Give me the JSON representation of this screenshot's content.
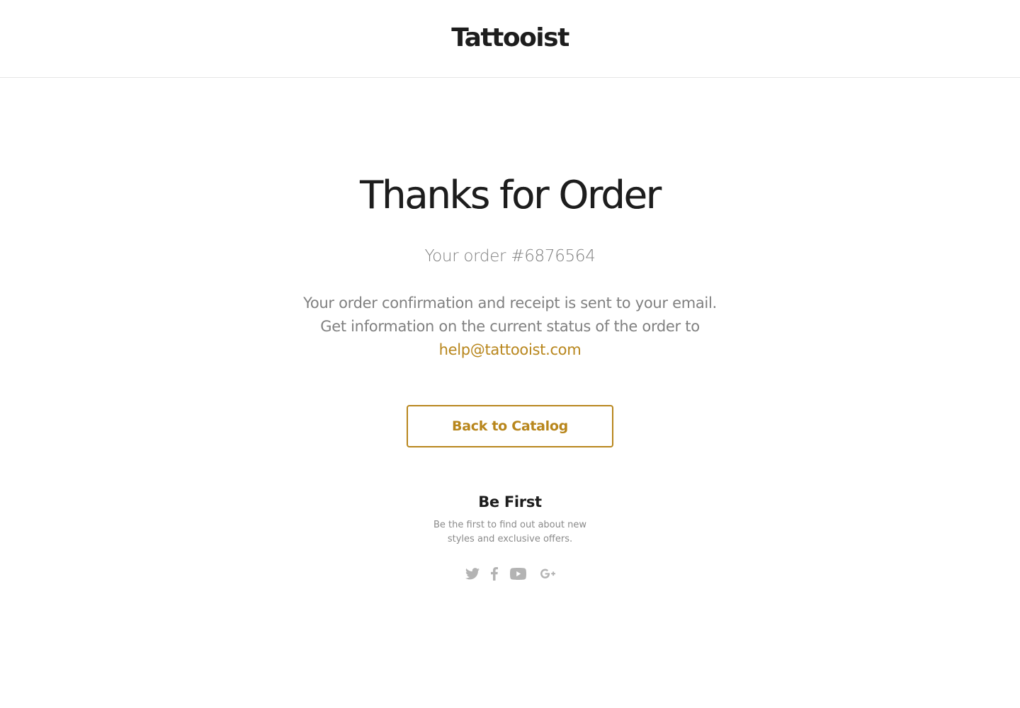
{
  "header": {
    "logo_text": "Tattooist"
  },
  "confirmation": {
    "title": "Thanks for Order",
    "order_number_text": "Your order #6876564",
    "info_line_1": "Your order confirmation and receipt is sent to your email.",
    "info_line_2": "Get information on the current status of the order to",
    "support_email": "help@tattooist.com",
    "back_button_label": "Back to Catalog"
  },
  "subscribe": {
    "title": "Be First",
    "text_line_1": "Be the first to find out about new",
    "text_line_2": "styles and exclusive offers."
  },
  "social": {
    "icons": [
      "twitter-icon",
      "facebook-icon",
      "youtube-icon",
      "google-plus-icon"
    ]
  },
  "colors": {
    "accent": "#b8861c",
    "text_dark": "#1d1d1d",
    "text_muted": "#808080",
    "icon_gray": "#b3b3b3"
  }
}
